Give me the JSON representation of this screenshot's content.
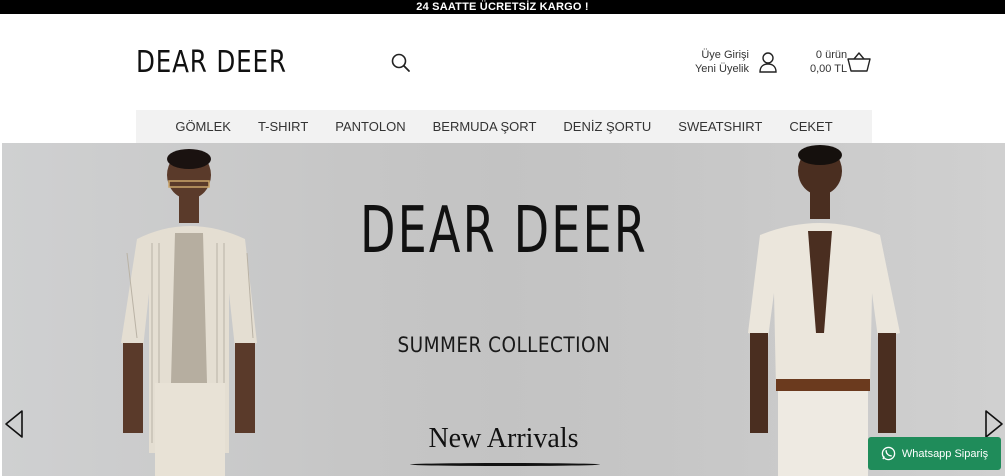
{
  "announcement": "24 SAATTE ÜCRETSİZ KARGO !",
  "brand": {
    "logo_text": "DEAR DEER"
  },
  "header": {
    "search_icon": "search-icon",
    "account": {
      "login_label": "Üye Girişi",
      "register_label": "Yeni Üyelik",
      "icon": "user-icon"
    },
    "cart": {
      "count_label": "0 ürün",
      "total_label": "0,00 TL",
      "icon": "basket-icon"
    }
  },
  "nav": {
    "items": [
      {
        "label": "GÖMLEK"
      },
      {
        "label": "T-SHIRT"
      },
      {
        "label": "PANTOLON"
      },
      {
        "label": "BERMUDA ŞORT"
      },
      {
        "label": "DENİZ ŞORTU"
      },
      {
        "label": "SWEATSHIRT"
      },
      {
        "label": "CEKET"
      }
    ]
  },
  "hero": {
    "brand_text": "DEAR DEER",
    "subtitle": "SUMMER COLLECTION",
    "cta": "New Arrivals",
    "prev_icon": "chevron-left-icon",
    "next_icon": "chevron-right-icon"
  },
  "whatsapp": {
    "label": "Whatsapp Sipariş",
    "icon": "whatsapp-icon",
    "color": "#1f8c5a"
  },
  "colors": {
    "topbar": "#000000",
    "nav_bg": "#f2f2f2",
    "hero_bg": "#c6c6c6"
  }
}
